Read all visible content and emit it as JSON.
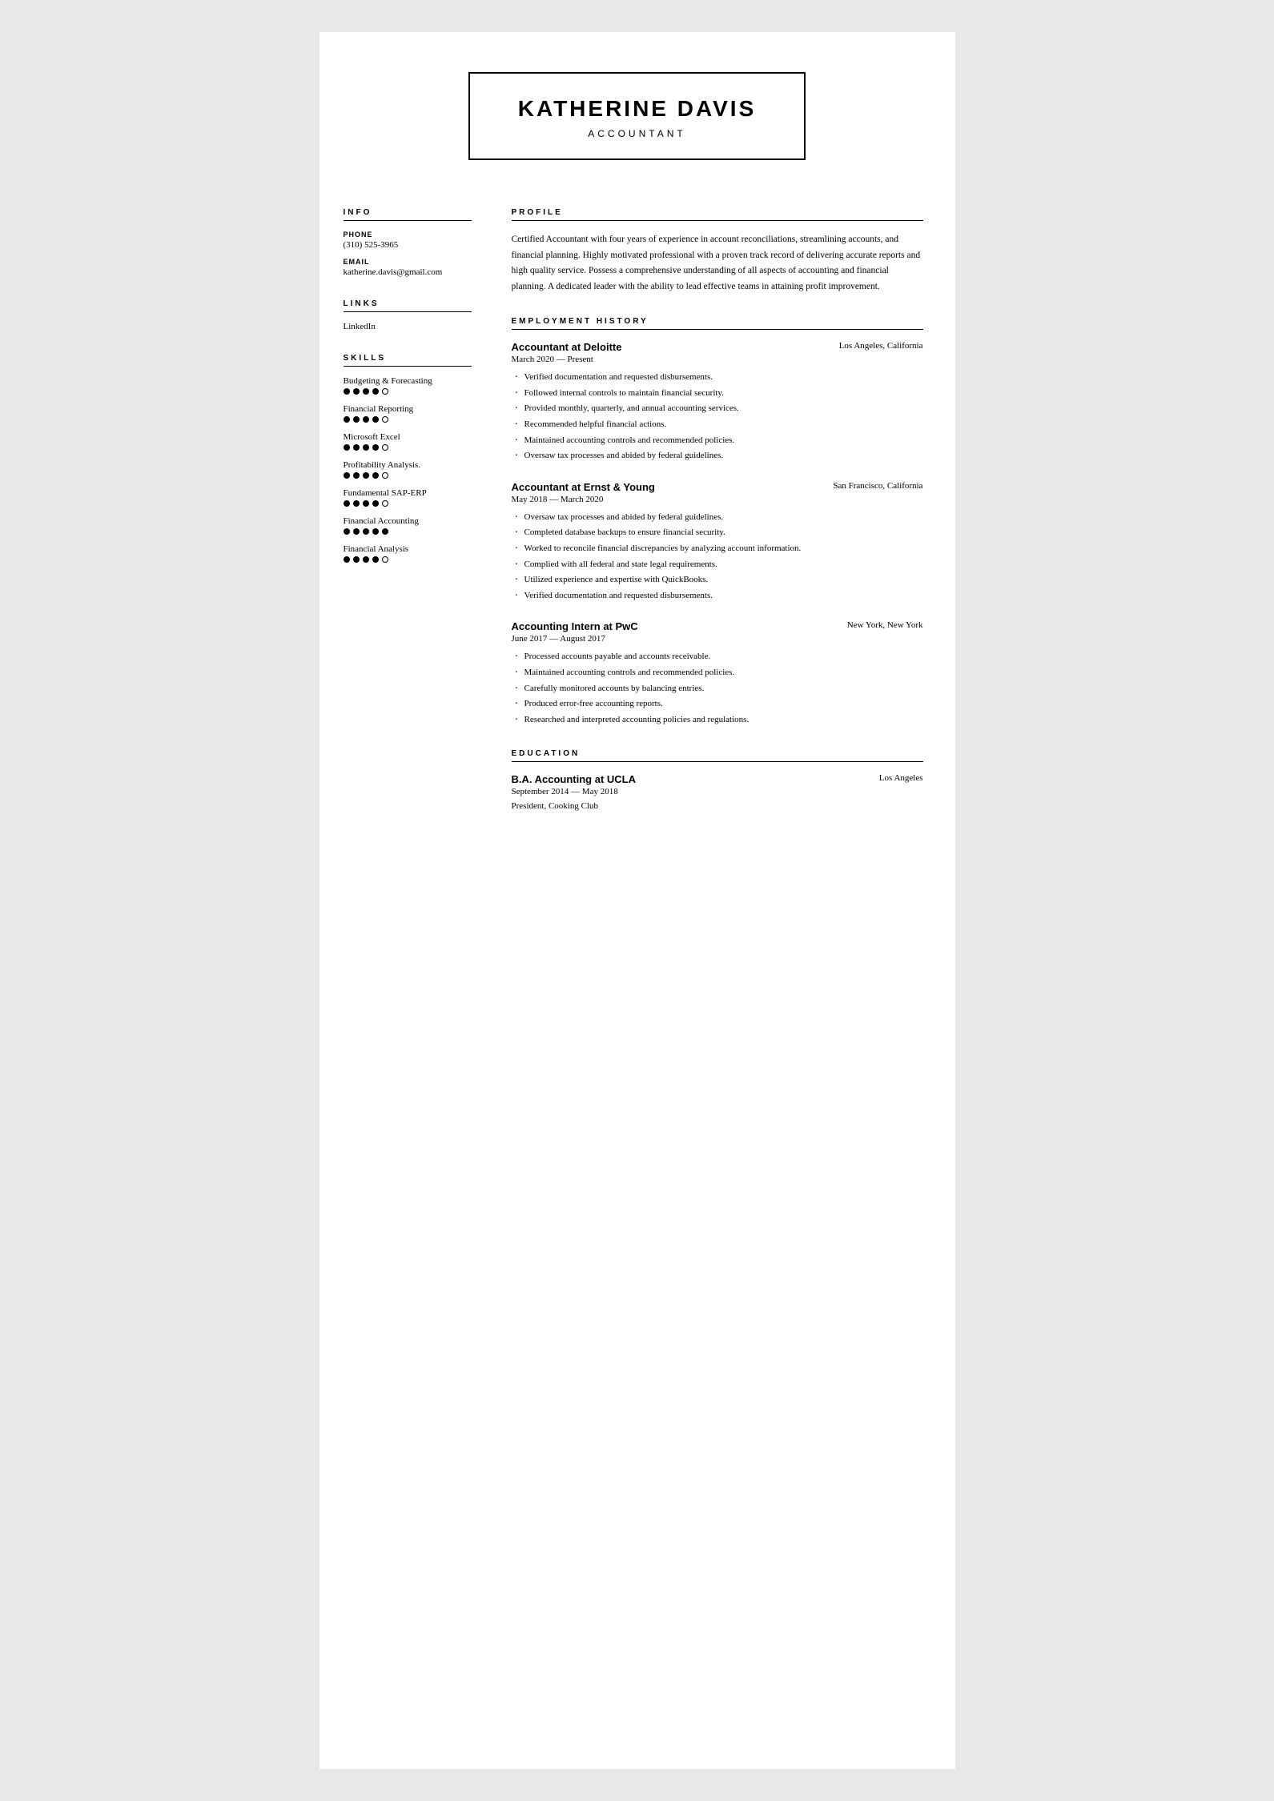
{
  "header": {
    "name": "KATHERINE DAVIS",
    "title": "ACCOUNTANT"
  },
  "sidebar": {
    "info_title": "INFO",
    "phone_label": "PHONE",
    "phone_value": "(310) 525-3965",
    "email_label": "EMAIL",
    "email_value": "katherine.davis@gmail.com",
    "links_title": "LINKS",
    "linkedin": "LinkedIn",
    "skills_title": "SKILLS",
    "skills": [
      {
        "name": "Budgeting & Forecasting",
        "filled": 4,
        "empty": 1
      },
      {
        "name": "Financial Reporting",
        "filled": 4,
        "empty": 1
      },
      {
        "name": "Microsoft Excel",
        "filled": 4,
        "empty": 1
      },
      {
        "name": "Profitability Analysis.",
        "filled": 4,
        "empty": 1
      },
      {
        "name": "Fundamental SAP-ERP",
        "filled": 4,
        "empty": 1
      },
      {
        "name": "Financial Accounting",
        "filled": 5,
        "empty": 0
      },
      {
        "name": "Financial Analysis",
        "filled": 4,
        "empty": 1
      }
    ]
  },
  "profile": {
    "title": "PROFILE",
    "text": "Certified Accountant with four years of experience in account reconciliations, streamlining accounts, and financial planning. Highly motivated professional with a proven track record of delivering accurate reports and high quality service. Possess a comprehensive understanding of all aspects of accounting and financial planning. A dedicated leader with the ability to lead effective teams in attaining profit improvement."
  },
  "employment": {
    "title": "EMPLOYMENT HISTORY",
    "jobs": [
      {
        "title": "Accountant at Deloitte",
        "location": "Los Angeles, California",
        "dates": "March 2020 — Present",
        "bullets": [
          "Verified documentation and requested disbursements.",
          "Followed internal controls to maintain financial security.",
          "Provided monthly, quarterly, and annual accounting services.",
          "Recommended helpful financial actions.",
          "Maintained accounting controls and recommended policies.",
          "Oversaw tax processes and abided by federal guidelines."
        ]
      },
      {
        "title": "Accountant at Ernst & Young",
        "location": "San Francisco, California",
        "dates": "May 2018 — March 2020",
        "bullets": [
          "Oversaw tax processes and abided by federal guidelines.",
          "Completed database backups to ensure financial security.",
          "Worked to reconcile financial discrepancies by analyzing account information.",
          "Complied with all federal and state legal requirements.",
          "Utilized experience and expertise with QuickBooks.",
          "Verified documentation and requested disbursements."
        ]
      },
      {
        "title": "Accounting Intern at PwC",
        "location": "New York, New York",
        "dates": "June 2017 — August 2017",
        "bullets": [
          "Processed accounts payable and accounts receivable.",
          "Maintained accounting controls and recommended policies.",
          "Carefully monitored accounts by balancing entries.",
          "Produced error-free accounting reports.",
          "Researched and interpreted accounting policies and regulations."
        ]
      }
    ]
  },
  "education": {
    "title": "EDUCATION",
    "entries": [
      {
        "title": "B.A. Accounting at UCLA",
        "location": "Los Angeles",
        "dates": "September 2014 — May 2018",
        "extra": "President, Cooking Club"
      }
    ]
  }
}
